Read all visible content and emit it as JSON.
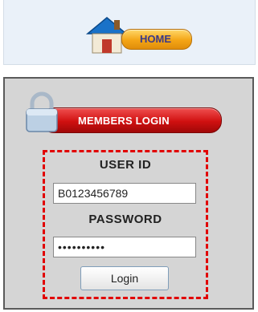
{
  "home": {
    "label": "HOME"
  },
  "members_login": {
    "label": "MEMBERS LOGIN"
  },
  "form": {
    "user_id_label": "USER ID",
    "user_id_value": "B0123456789",
    "password_label": "PASSWORD",
    "password_masked": "••••••••••",
    "login_button": "Login"
  },
  "colors": {
    "highlight_border": "#e10000",
    "home_button": "#f4a516",
    "members_button": "#d01010"
  }
}
